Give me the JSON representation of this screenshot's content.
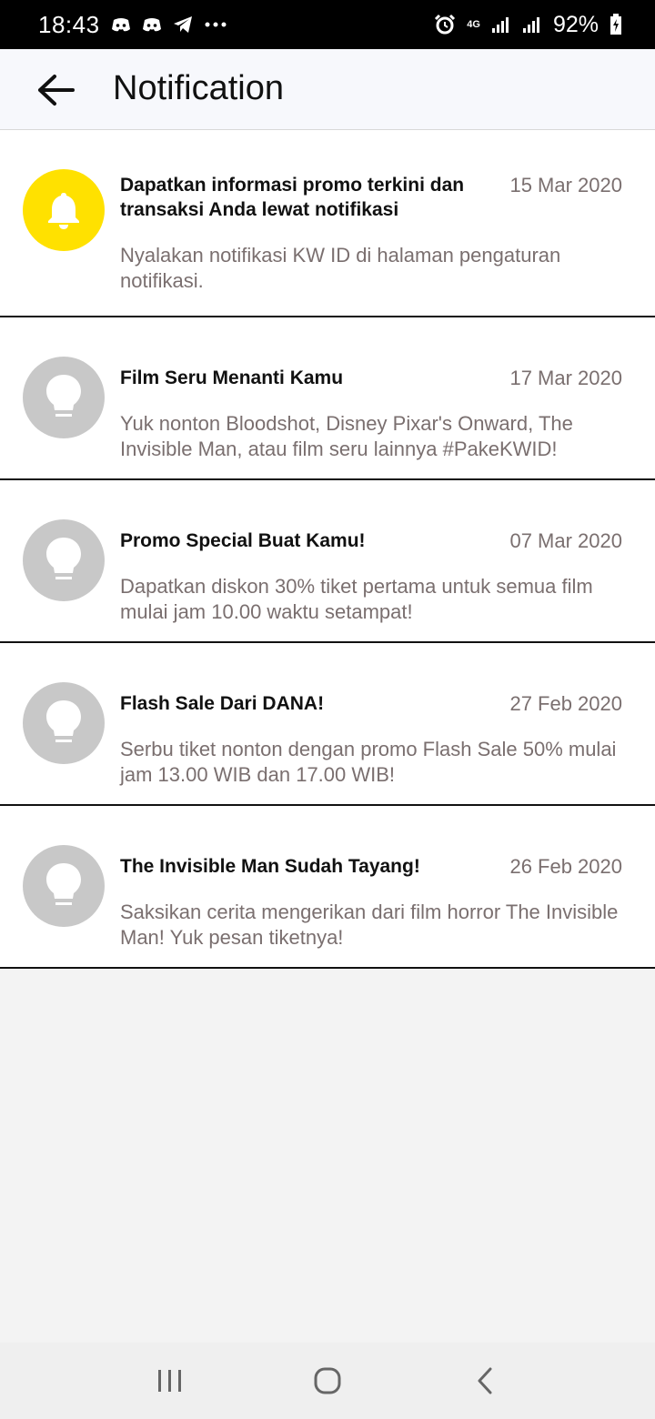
{
  "status_bar": {
    "time": "18:43",
    "network": "4G",
    "battery": "92%",
    "icons": [
      "discord-icon",
      "discord-icon",
      "telegram-icon",
      "more-dots-icon",
      "alarm-icon",
      "signal-icon",
      "signal-icon",
      "battery-icon"
    ]
  },
  "app_bar": {
    "title": "Notification",
    "back_icon": "arrow-left-icon"
  },
  "notifications": [
    {
      "icon": "bell-icon",
      "icon_bg": "#ffe100",
      "title": "Dapatkan informasi promo terkini dan transaksi Anda lewat notifikasi",
      "date": "15 Mar 2020",
      "body": "Nyalakan notifikasi KW ID di halaman pengaturan notifikasi."
    },
    {
      "icon": "lightbulb-icon",
      "icon_bg": "#c8c8c8",
      "title": "Film Seru Menanti Kamu",
      "date": "17 Mar 2020",
      "body": "Yuk nonton Bloodshot, Disney Pixar's Onward, The Invisible Man, atau film seru lainnya #PakeKWID!"
    },
    {
      "icon": "lightbulb-icon",
      "icon_bg": "#c8c8c8",
      "title": "Promo Special Buat Kamu!",
      "date": "07 Mar 2020",
      "body": "Dapatkan diskon 30% tiket pertama untuk semua film mulai jam 10.00 waktu setampat!"
    },
    {
      "icon": "lightbulb-icon",
      "icon_bg": "#c8c8c8",
      "title": "Flash Sale Dari DANA!",
      "date": "27 Feb 2020",
      "body": "Serbu tiket nonton dengan promo Flash Sale 50% mulai jam 13.00 WIB dan 17.00 WIB!"
    },
    {
      "icon": "lightbulb-icon",
      "icon_bg": "#c8c8c8",
      "title": "The Invisible Man Sudah Tayang!",
      "date": "26 Feb 2020",
      "body": "Saksikan cerita mengerikan dari film horror The Invisible Man! Yuk pesan tiketnya!"
    }
  ],
  "nav_bar": {
    "icons": [
      "recent-apps-icon",
      "home-icon",
      "back-icon"
    ]
  },
  "colors": {
    "accent_yellow": "#ffe100",
    "muted_text": "#7a6f6f",
    "placeholder_icon": "#c8c8c8"
  }
}
